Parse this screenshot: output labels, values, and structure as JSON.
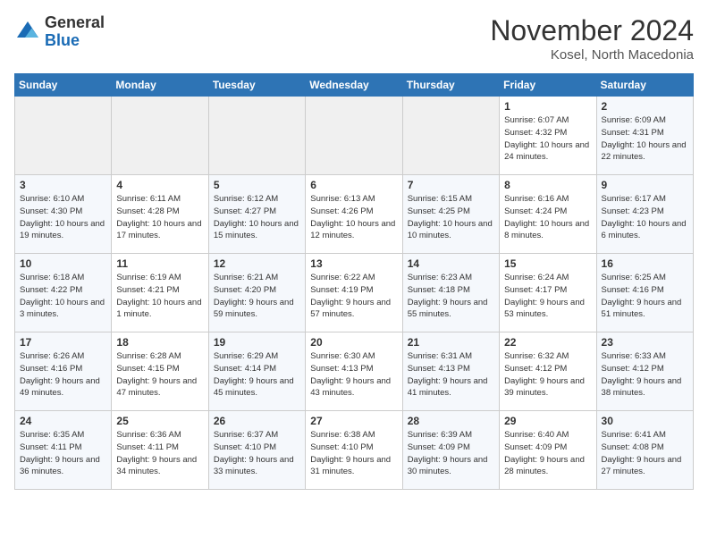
{
  "header": {
    "logo_general": "General",
    "logo_blue": "Blue",
    "month_title": "November 2024",
    "subtitle": "Kosel, North Macedonia"
  },
  "weekdays": [
    "Sunday",
    "Monday",
    "Tuesday",
    "Wednesday",
    "Thursday",
    "Friday",
    "Saturday"
  ],
  "weeks": [
    [
      {
        "day": "",
        "info": ""
      },
      {
        "day": "",
        "info": ""
      },
      {
        "day": "",
        "info": ""
      },
      {
        "day": "",
        "info": ""
      },
      {
        "day": "",
        "info": ""
      },
      {
        "day": "1",
        "info": "Sunrise: 6:07 AM\nSunset: 4:32 PM\nDaylight: 10 hours and 24 minutes."
      },
      {
        "day": "2",
        "info": "Sunrise: 6:09 AM\nSunset: 4:31 PM\nDaylight: 10 hours and 22 minutes."
      }
    ],
    [
      {
        "day": "3",
        "info": "Sunrise: 6:10 AM\nSunset: 4:30 PM\nDaylight: 10 hours and 19 minutes."
      },
      {
        "day": "4",
        "info": "Sunrise: 6:11 AM\nSunset: 4:28 PM\nDaylight: 10 hours and 17 minutes."
      },
      {
        "day": "5",
        "info": "Sunrise: 6:12 AM\nSunset: 4:27 PM\nDaylight: 10 hours and 15 minutes."
      },
      {
        "day": "6",
        "info": "Sunrise: 6:13 AM\nSunset: 4:26 PM\nDaylight: 10 hours and 12 minutes."
      },
      {
        "day": "7",
        "info": "Sunrise: 6:15 AM\nSunset: 4:25 PM\nDaylight: 10 hours and 10 minutes."
      },
      {
        "day": "8",
        "info": "Sunrise: 6:16 AM\nSunset: 4:24 PM\nDaylight: 10 hours and 8 minutes."
      },
      {
        "day": "9",
        "info": "Sunrise: 6:17 AM\nSunset: 4:23 PM\nDaylight: 10 hours and 6 minutes."
      }
    ],
    [
      {
        "day": "10",
        "info": "Sunrise: 6:18 AM\nSunset: 4:22 PM\nDaylight: 10 hours and 3 minutes."
      },
      {
        "day": "11",
        "info": "Sunrise: 6:19 AM\nSunset: 4:21 PM\nDaylight: 10 hours and 1 minute."
      },
      {
        "day": "12",
        "info": "Sunrise: 6:21 AM\nSunset: 4:20 PM\nDaylight: 9 hours and 59 minutes."
      },
      {
        "day": "13",
        "info": "Sunrise: 6:22 AM\nSunset: 4:19 PM\nDaylight: 9 hours and 57 minutes."
      },
      {
        "day": "14",
        "info": "Sunrise: 6:23 AM\nSunset: 4:18 PM\nDaylight: 9 hours and 55 minutes."
      },
      {
        "day": "15",
        "info": "Sunrise: 6:24 AM\nSunset: 4:17 PM\nDaylight: 9 hours and 53 minutes."
      },
      {
        "day": "16",
        "info": "Sunrise: 6:25 AM\nSunset: 4:16 PM\nDaylight: 9 hours and 51 minutes."
      }
    ],
    [
      {
        "day": "17",
        "info": "Sunrise: 6:26 AM\nSunset: 4:16 PM\nDaylight: 9 hours and 49 minutes."
      },
      {
        "day": "18",
        "info": "Sunrise: 6:28 AM\nSunset: 4:15 PM\nDaylight: 9 hours and 47 minutes."
      },
      {
        "day": "19",
        "info": "Sunrise: 6:29 AM\nSunset: 4:14 PM\nDaylight: 9 hours and 45 minutes."
      },
      {
        "day": "20",
        "info": "Sunrise: 6:30 AM\nSunset: 4:13 PM\nDaylight: 9 hours and 43 minutes."
      },
      {
        "day": "21",
        "info": "Sunrise: 6:31 AM\nSunset: 4:13 PM\nDaylight: 9 hours and 41 minutes."
      },
      {
        "day": "22",
        "info": "Sunrise: 6:32 AM\nSunset: 4:12 PM\nDaylight: 9 hours and 39 minutes."
      },
      {
        "day": "23",
        "info": "Sunrise: 6:33 AM\nSunset: 4:12 PM\nDaylight: 9 hours and 38 minutes."
      }
    ],
    [
      {
        "day": "24",
        "info": "Sunrise: 6:35 AM\nSunset: 4:11 PM\nDaylight: 9 hours and 36 minutes."
      },
      {
        "day": "25",
        "info": "Sunrise: 6:36 AM\nSunset: 4:11 PM\nDaylight: 9 hours and 34 minutes."
      },
      {
        "day": "26",
        "info": "Sunrise: 6:37 AM\nSunset: 4:10 PM\nDaylight: 9 hours and 33 minutes."
      },
      {
        "day": "27",
        "info": "Sunrise: 6:38 AM\nSunset: 4:10 PM\nDaylight: 9 hours and 31 minutes."
      },
      {
        "day": "28",
        "info": "Sunrise: 6:39 AM\nSunset: 4:09 PM\nDaylight: 9 hours and 30 minutes."
      },
      {
        "day": "29",
        "info": "Sunrise: 6:40 AM\nSunset: 4:09 PM\nDaylight: 9 hours and 28 minutes."
      },
      {
        "day": "30",
        "info": "Sunrise: 6:41 AM\nSunset: 4:08 PM\nDaylight: 9 hours and 27 minutes."
      }
    ]
  ]
}
